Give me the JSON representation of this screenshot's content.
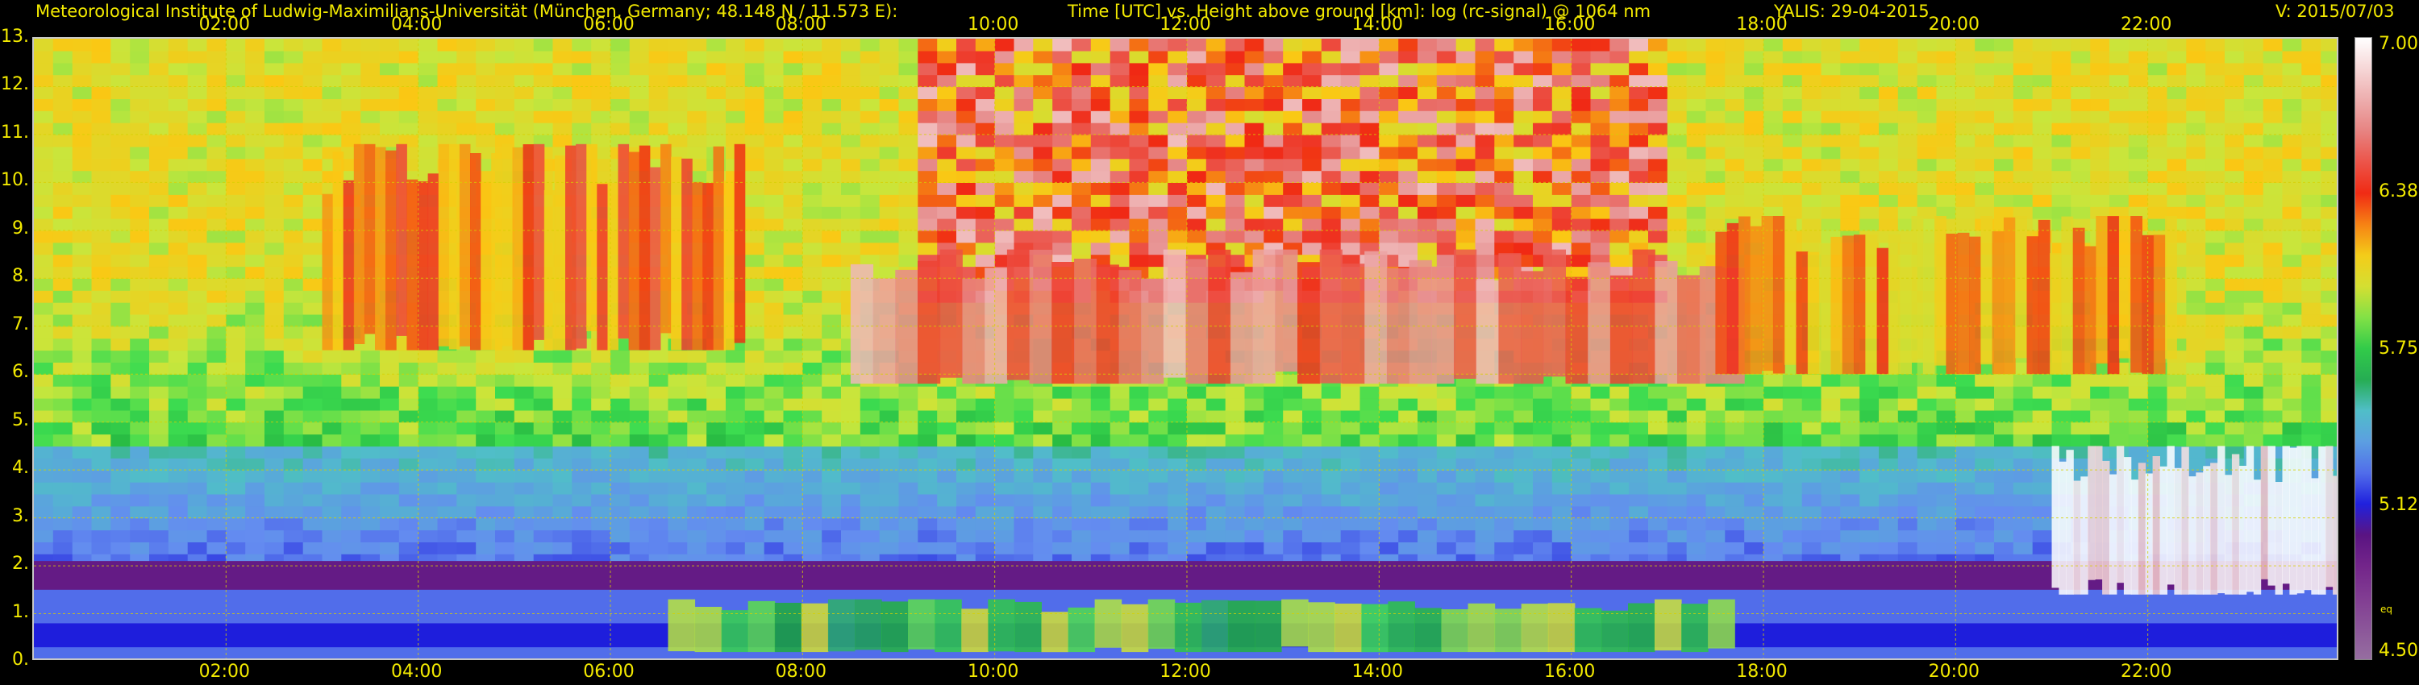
{
  "header": {
    "institute": "Meteorological Institute of Ludwig-Maximilians-Universität (München, Germany; 48.148 N / 11.573 E):",
    "description": "Time [UTC] vs. Height above ground [km]: log (rc-signal) @ 1064 nm",
    "instrument_date": "YALIS: 29-04-2015",
    "version": "V: 2015/07/03"
  },
  "chart_data": {
    "type": "heatmap",
    "title": "Time [UTC] vs. Height above ground [km]: log (rc-signal) @ 1064 nm",
    "xlabel": "Time [UTC]",
    "ylabel": "Height above ground [km]",
    "xlim": [
      0,
      24
    ],
    "ylim": [
      0,
      13
    ],
    "x_ticks": [
      "02:00",
      "04:00",
      "06:00",
      "08:00",
      "10:00",
      "12:00",
      "14:00",
      "16:00",
      "18:00",
      "20:00",
      "22:00"
    ],
    "x_tick_values": [
      2,
      4,
      6,
      8,
      10,
      12,
      14,
      16,
      18,
      20,
      22
    ],
    "y_ticks": [
      "0.",
      "1.",
      "2.",
      "3.",
      "4.",
      "5.",
      "6.",
      "7.",
      "8.",
      "9.",
      "10.",
      "11.",
      "12.",
      "13."
    ],
    "y_tick_values": [
      0,
      1,
      2,
      3,
      4,
      5,
      6,
      7,
      8,
      9,
      10,
      11,
      12,
      13
    ],
    "grid": true,
    "colorbar": {
      "range": [
        4.5,
        7.0
      ],
      "tick_labels": [
        "4.50",
        "5.12",
        "5.75",
        "6.38",
        "7.00"
      ],
      "tick_values": [
        4.5,
        5.12,
        5.75,
        6.38,
        7.0
      ],
      "note": "eq"
    },
    "features": [
      {
        "kind": "boundary_layer",
        "t": [
          0,
          24
        ],
        "top_km": 2.1,
        "level": 5.0
      },
      {
        "kind": "aerosol_layer",
        "t": [
          6.6,
          17.7
        ],
        "bottom_km": 0.2,
        "top_km": 1.3,
        "level": 5.8
      },
      {
        "kind": "cirrus",
        "t": [
          3.0,
          7.4
        ],
        "top_km": 10.8,
        "bottom_km": 6.5,
        "level": 6.3
      },
      {
        "kind": "cirrus",
        "t": [
          8.5,
          17.8
        ],
        "top_km": 8.6,
        "bottom_km": 5.8,
        "level": 6.6
      },
      {
        "kind": "cirrus",
        "t": [
          17.5,
          22.3
        ],
        "top_km": 9.3,
        "bottom_km": 6.0,
        "level": 6.2
      },
      {
        "kind": "mid_cloud",
        "t": [
          21.0,
          24
        ],
        "top_km": 4.5,
        "bottom_km": 1.4,
        "level": 7.0
      }
    ]
  }
}
